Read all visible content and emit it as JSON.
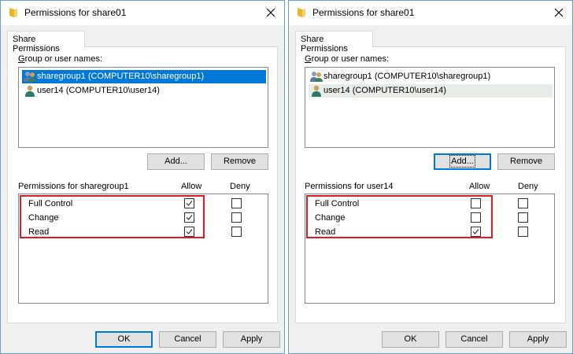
{
  "dialogs": [
    {
      "title": "Permissions for share01",
      "tab": "Share Permissions",
      "group_label": "Group or user names:",
      "users": [
        {
          "label": "sharegroup1 (COMPUTER10\\sharegroup1)",
          "icon": "group-icon",
          "selected": true
        },
        {
          "label": "user14 (COMPUTER10\\user14)",
          "icon": "user-icon",
          "selected": false
        }
      ],
      "add_label": "Add...",
      "remove_label": "Remove",
      "perm_label": "Permissions for sharegroup1",
      "allow_header": "Allow",
      "deny_header": "Deny",
      "permissions": [
        {
          "name": "Full Control",
          "allow": true,
          "deny": false
        },
        {
          "name": "Change",
          "allow": true,
          "deny": false
        },
        {
          "name": "Read",
          "allow": true,
          "deny": false
        }
      ],
      "ok_label": "OK",
      "cancel_label": "Cancel",
      "apply_label": "Apply"
    },
    {
      "title": "Permissions for share01",
      "tab": "Share Permissions",
      "group_label": "Group or user names:",
      "users": [
        {
          "label": "sharegroup1 (COMPUTER10\\sharegroup1)",
          "icon": "group-icon",
          "selected": false
        },
        {
          "label": "user14 (COMPUTER10\\user14)",
          "icon": "user-icon",
          "selected": true
        }
      ],
      "add_label": "Add...",
      "remove_label": "Remove",
      "perm_label": "Permissions for user14",
      "allow_header": "Allow",
      "deny_header": "Deny",
      "permissions": [
        {
          "name": "Full Control",
          "allow": false,
          "deny": false
        },
        {
          "name": "Change",
          "allow": false,
          "deny": false
        },
        {
          "name": "Read",
          "allow": true,
          "deny": false
        }
      ],
      "ok_label": "OK",
      "cancel_label": "Cancel",
      "apply_label": "Apply"
    }
  ],
  "colors": {
    "selection_blue": "#0078d7",
    "highlight_red": "#e01b24",
    "dialog_border": "#6d9ccf"
  }
}
